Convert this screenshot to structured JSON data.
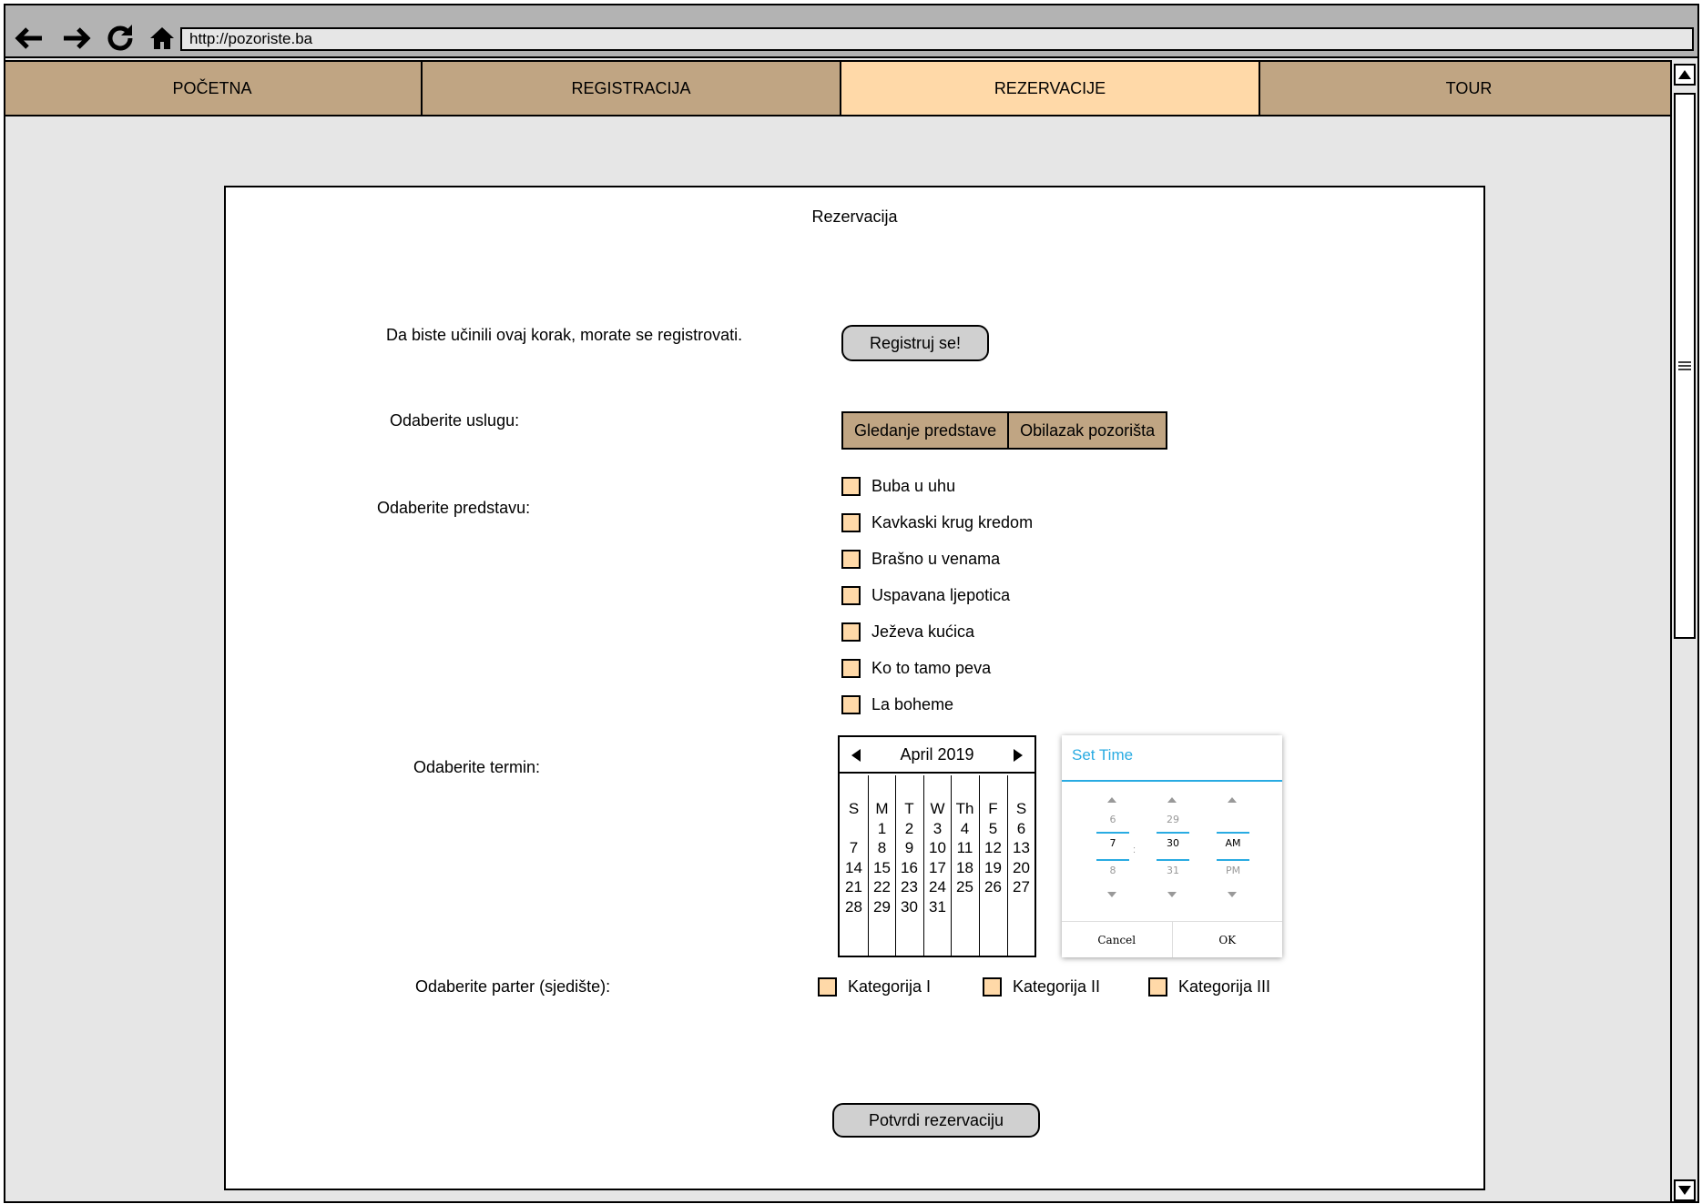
{
  "browser": {
    "url": "http://pozoriste.ba",
    "icons": [
      "back-icon",
      "forward-icon",
      "reload-icon",
      "home-icon"
    ]
  },
  "tabs": [
    {
      "label": "POČETNA",
      "active": false
    },
    {
      "label": "REGISTRACIJA",
      "active": false
    },
    {
      "label": "REZERVACIJE",
      "active": true
    },
    {
      "label": "TOUR",
      "active": false
    }
  ],
  "colors": {
    "tab": "#c0a583",
    "tab_active": "#ffd9a8",
    "checkbox": "#ffd9a8",
    "accent": "#29abe2"
  },
  "panel": {
    "title": "Rezervacija",
    "register_prompt": "Da biste učinili ovaj korak, morate se registrovati.",
    "register_button": "Registruj se!",
    "service_label": "Odaberite uslugu:",
    "services": [
      "Gledanje predstave",
      "Obilazak pozorišta"
    ],
    "show_label": "Odaberite predstavu:",
    "shows": [
      "Buba u uhu",
      "Kavkaski krug kredom",
      "Brašno u venama",
      "Uspavana ljepotica",
      "Ježeva kućica",
      "Ko to tamo peva",
      "La boheme"
    ],
    "date_label": "Odaberite termin:",
    "seat_label": "Odaberite parter (sjedište):",
    "seat_categories": [
      "Kategorija I",
      "Kategorija II",
      "Kategorija III"
    ],
    "confirm_button": "Potvrdi rezervaciju"
  },
  "calendar": {
    "month": "April 2019",
    "weekdays": [
      "S",
      "M",
      "T",
      "W",
      "Th",
      "F",
      "S"
    ],
    "weeks": [
      [
        "",
        "1",
        "2",
        "3",
        "4",
        "5",
        "6"
      ],
      [
        "7",
        "8",
        "9",
        "10",
        "11",
        "12",
        "13"
      ],
      [
        "14",
        "15",
        "16",
        "17",
        "18",
        "19",
        "20"
      ],
      [
        "21",
        "22",
        "23",
        "24",
        "25",
        "26",
        "27"
      ],
      [
        "28",
        "29",
        "30",
        "31",
        "",
        "",
        ""
      ]
    ]
  },
  "timepicker": {
    "title": "Set Time",
    "hour": {
      "prev": "6",
      "value": "7",
      "next": "8"
    },
    "minute": {
      "prev": "29",
      "value": "30",
      "next": "31"
    },
    "period": {
      "prev": "",
      "value": "AM",
      "next": "PM"
    },
    "separator": ":",
    "cancel": "Cancel",
    "ok": "OK"
  }
}
